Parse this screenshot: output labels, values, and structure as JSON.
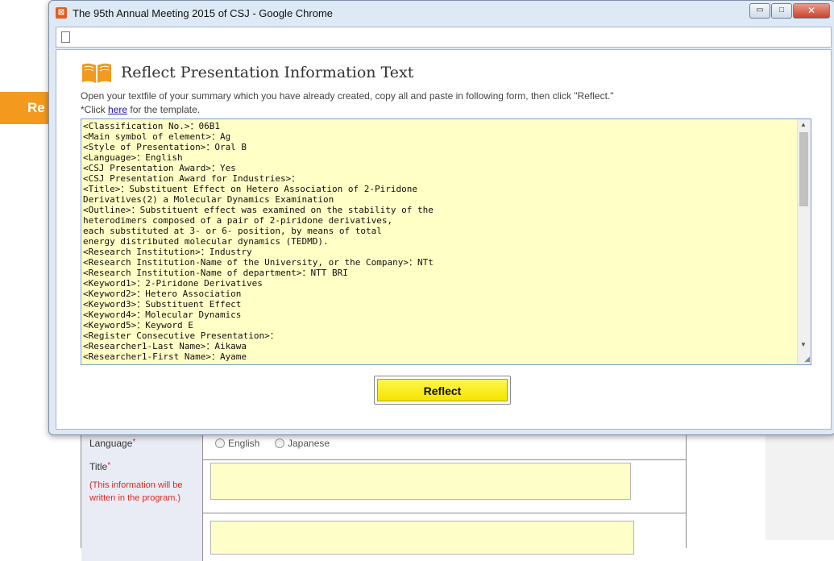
{
  "background": {
    "orange_tab_label": "Re",
    "form": {
      "language_label": "Language",
      "required_mark": "*",
      "language_options": [
        "English",
        "Japanese"
      ],
      "title_label": "Title",
      "title_note": "(This information will be\nwritten in the program.)"
    }
  },
  "window": {
    "title": "The 95th Annual Meeting 2015 of CSJ - Google Chrome",
    "controls": {
      "minimize": "▭",
      "maximize": "□",
      "close": "✕"
    }
  },
  "dialog": {
    "heading": "Reflect Presentation Information Text",
    "instruction": "Open your textfile of your summary which you have already created, copy all and paste in following form, then click \"Reflect.\"",
    "click_prefix": "*Click ",
    "click_link": "here",
    "click_suffix": " for the template.",
    "paste_text": "<Classification No.>：06B1\n<Main symbol of element>：Ag\n<Style of Presentation>：Oral B\n<Language>：English\n<CSJ Presentation Award>：Yes\n<CSJ Presentation Award for Industries>：\n<Title>：Substituent Effect on Hetero Association of 2-Piridone\nDerivatives(2) a Molecular Dynamics Examination\n<Outline>：Substituent effect was examined on the stability of the\nheterodimers composed of a pair of 2-piridone derivatives,\neach substituted at 3- or 6- position, by means of total\nenergy distributed molecular dynamics (TEDMD).\n<Research Institution>：Industry\n<Research Institution-Name of the University, or the Company>：NTt\n<Research Institution-Name of department>：NTT BRI\n<Keyword1>：2-Piridone Derivatives\n<Keyword2>：Hetero Association\n<Keyword3>：Substituent Effect\n<Keyword4>：Molecular Dynamics\n<Keyword5>：Keyword E\n<Register Consecutive Presentation>：\n<Researcher1-Last Name>：Aikawa\n<Researcher1-First Name>：Ayame",
    "reflect_label": "Reflect"
  }
}
